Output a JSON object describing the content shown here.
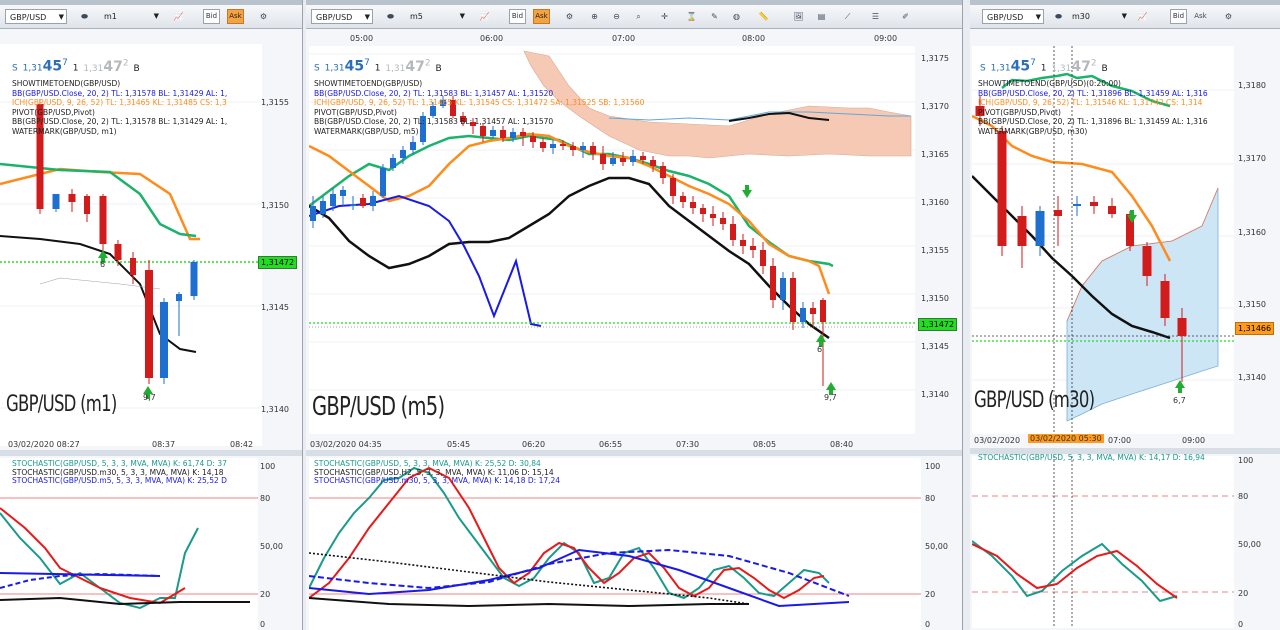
{
  "colors": {
    "green_band": "#1bb36a",
    "orange_line": "#ff8c1a",
    "black_line": "#111111",
    "blue_line": "#1a1ae6",
    "bull_candle": "#1f6fd1",
    "bear_candle": "#d21b1b",
    "cloud_red": "#f6c9b5",
    "cloud_blue": "#cde6f5",
    "pivot_green": "#22dd22"
  },
  "panes": [
    {
      "symbol": "GBP/USD",
      "timeframe": "m1",
      "quote": {
        "s_label": "S",
        "big_prefix": "1,31",
        "big": "45",
        "sup": "7",
        "mid": "1",
        "grey_prefix": "1,31",
        "grey_big": "47",
        "grey_sup": "2",
        "b_label": "B"
      },
      "indicator_labels": [
        "SHOWTIMETOEND(GBP/USD)",
        "BB(GBP/USD.Close, 20, 2)  TL: 1,31578  BL: 1,31429  AL: 1,",
        "ICH(GBP/USD, 9, 26, 52)  TL: 1,31465  KL: 1,31485  CS: 1,3",
        "PIVOT(GBP/USD,Pivot)",
        "BB(GBP/USD.Close, 20, 2)  TL: 1,31578  BL: 1,31429  AL: 1,",
        "WATERMARK(GBP/USD, m1)"
      ],
      "watermark": "GBP/USD (m1)",
      "price_ticks": [
        "1,3155",
        "1,3150",
        "1,3145",
        "1,3140"
      ],
      "time_ticks": [
        "03/02/2020 08:27",
        "08:37",
        "08:42"
      ],
      "current_price": "1,31472",
      "arrow_labels": [
        "6",
        "9,7"
      ],
      "stoch_labels": [
        "STOCHASTIC(GBP/USD, 5, 3, 3, MVA, MVA)  K: 61,74  D: 37",
        "STOCHASTIC(GBP/USD.m30, 5, 3, 3, MVA, MVA)  K: 14,18",
        "STOCHASTIC(GBP/USD.m5, 5, 3, 3, MVA, MVA)  K: 25,52  D"
      ],
      "stoch_ticks": [
        "100",
        "80",
        "50,00",
        "20",
        "0"
      ]
    },
    {
      "symbol": "GBP/USD",
      "timeframe": "m5",
      "quote": {
        "s_label": "S",
        "big_prefix": "1,31",
        "big": "45",
        "sup": "7",
        "mid": "1",
        "grey_prefix": "1,31",
        "grey_big": "47",
        "grey_sup": "2",
        "b_label": "B"
      },
      "indicator_labels": [
        "SHOWTIMETOEND(GBP/USD)",
        "BB(GBP/USD.Close, 20, 2)  TL: 1,31583  BL: 1,31457  AL: 1,31520",
        "ICH(GBP/USD, 9, 26, 52)  TL: 1,31465  KL: 1,31545  CS: 1,31472  SA: 1,31525  SB: 1,31560",
        "PIVOT(GBP/USD,Pivot)",
        "BB(GBP/USD.Close, 20, 2)  TL: 1,31583  BL: 1,31457  AL: 1,31570",
        "WATERMARK(GBP/USD, m5)"
      ],
      "watermark": "GBP/USD (m5)",
      "price_ticks": [
        "1,3175",
        "1,3170",
        "1,3165",
        "1,3160",
        "1,3155",
        "1,3150",
        "1,3145",
        "1,3140"
      ],
      "top_time_ticks": [
        "05:00",
        "06:00",
        "07:00",
        "08:00",
        "09:00"
      ],
      "time_ticks": [
        "03/02/2020 04:35",
        "05:45",
        "06:20",
        "06:55",
        "07:30",
        "08:05",
        "08:40"
      ],
      "current_price": "1,31472",
      "arrow_labels": [
        "6",
        "9,7"
      ],
      "stoch_labels": [
        "STOCHASTIC(GBP/USD, 5, 3, 3, MVA, MVA)  K: 25,52  D: 30,84",
        "STOCHASTIC(GBP/USD.H2, 5, 3, 3, MVA, MVA)  K: 11,06  D: 15,14",
        "STOCHASTIC(GBP/USD.m30, 5, 3, 3, MVA, MVA)  K: 14,18  D: 17,24"
      ],
      "stoch_ticks": [
        "100",
        "80",
        "50,00",
        "20",
        "0"
      ]
    },
    {
      "symbol": "GBP/USD",
      "timeframe": "m30",
      "quote": {
        "s_label": "S",
        "big_prefix": "1,31",
        "big": "45",
        "sup": "7",
        "mid": "1",
        "grey_prefix": "1,31",
        "grey_big": "47",
        "grey_sup": "2",
        "b_label": "B"
      },
      "indicator_labels": [
        "SHOWTIMETOEND(GBP/USD)(0:20:00)",
        "BB(GBP/USD.Close, 20, 2)  TL: 1,31896  BL: 1,31459  AL: 1,316",
        "ICH(GBP/USD, 9, 26, 52)  TL: 1,31546  KL: 1,31742  CS: 1,314",
        "PIVOT(GBP/USD,Pivot)",
        "BB(GBP/USD.Close, 20, 2)  TL: 1,31896  BL: 1,31459  AL: 1,316",
        "WATERMARK(GBP/USD, m30)"
      ],
      "watermark": "GBP/USD (m30)",
      "price_ticks": [
        "1,3180",
        "1,3170",
        "1,3160",
        "1,3150",
        "1,3140"
      ],
      "time_ticks": [
        "03/02/2020",
        "03/02/2020 05:30",
        "07:00",
        "09:00"
      ],
      "current_price": "1,31466",
      "arrow_labels": [
        "6,7"
      ],
      "stoch_labels": [
        "STOCHASTIC(GBP/USD, 5, 3, 3, MVA, MVA)  K: 14,17  D: 16,94"
      ],
      "stoch_ticks": [
        "100",
        "80",
        "50,00",
        "20",
        "0"
      ]
    }
  ],
  "toolbar": {
    "bid_label": "Bid",
    "ask_label": "Ask"
  }
}
